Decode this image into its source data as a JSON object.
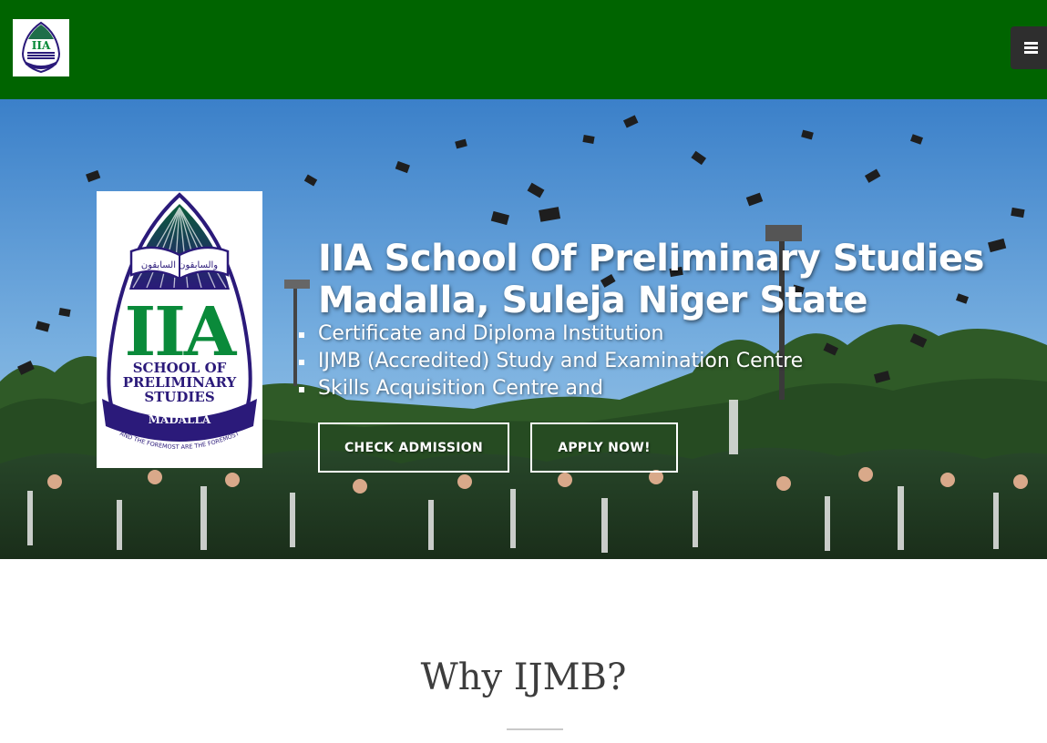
{
  "header": {
    "logo_icon": "iia-crest-icon",
    "menu_icon": "hamburger-menu-icon",
    "background_color": "#006400"
  },
  "hero": {
    "crest": {
      "arabic_text": "والسابقون السابقون",
      "initials": "IIA",
      "name_lines": [
        "SCHOOL OF",
        "PRELIMINARY",
        "STUDIES"
      ],
      "location": "MADALLA",
      "motto": "AND THE FOREMOST ARE THE FOREMOST"
    },
    "title_line1": "IIA School Of Preliminary Studies",
    "title_line2": "Madalla, Suleja Niger State",
    "bullets": [
      "Certificate and Diploma Institution",
      "IJMB (Accredited) Study and Examination Centre",
      "Skills Acquisition Centre and"
    ],
    "buttons": {
      "check_admission": "CHECK ADMISSION",
      "apply_now": "APPLY NOW!"
    }
  },
  "section": {
    "title": "Why IJMB?"
  },
  "colors": {
    "brand_green": "#006400",
    "crest_green": "#0a8a3a",
    "crest_purple": "#2b1a7a",
    "menu_button": "#2e2e2e",
    "heading_text": "#3d3d3d"
  }
}
